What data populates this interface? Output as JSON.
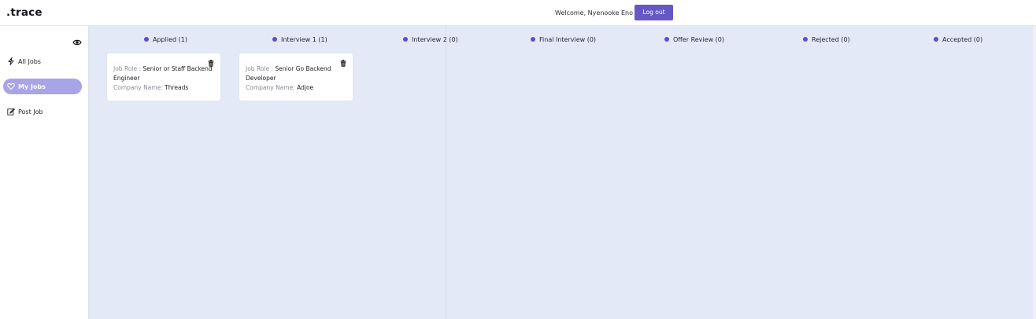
{
  "header": {
    "logo": ".trace",
    "welcome": "Welcome, Nyenooke Eno",
    "logout_label": "Log out"
  },
  "sidebar": {
    "toggle_icon": "eye-icon",
    "items": [
      {
        "label": "All Jobs",
        "icon": "sparkle-icon",
        "active": false
      },
      {
        "label": "My Jobs",
        "icon": "heart-icon",
        "active": true
      },
      {
        "label": "Post Job",
        "icon": "edit-icon",
        "active": false
      }
    ]
  },
  "board": {
    "accent_color": "#6558c4",
    "columns": [
      {
        "label": "Applied (1)"
      },
      {
        "label": "Interview 1 (1)"
      },
      {
        "label": "Interview 2 (0)"
      },
      {
        "label": "Final Interview (0)"
      },
      {
        "label": "Offer Review (0)"
      },
      {
        "label": "Rejected (0)"
      },
      {
        "label": "Accepted (0)"
      }
    ],
    "cards": [
      {
        "role_label": "Job Role :",
        "role": "Senior or Staff Backend Engineer",
        "company_label": "Company Name:",
        "company": "Threads",
        "delete_icon": "trash-icon"
      },
      {
        "role_label": "Job Role :",
        "role": "Senior Go Backend Developer",
        "company_label": "Company Name:",
        "company": "Adjoe",
        "delete_icon": "trash-icon"
      }
    ]
  }
}
